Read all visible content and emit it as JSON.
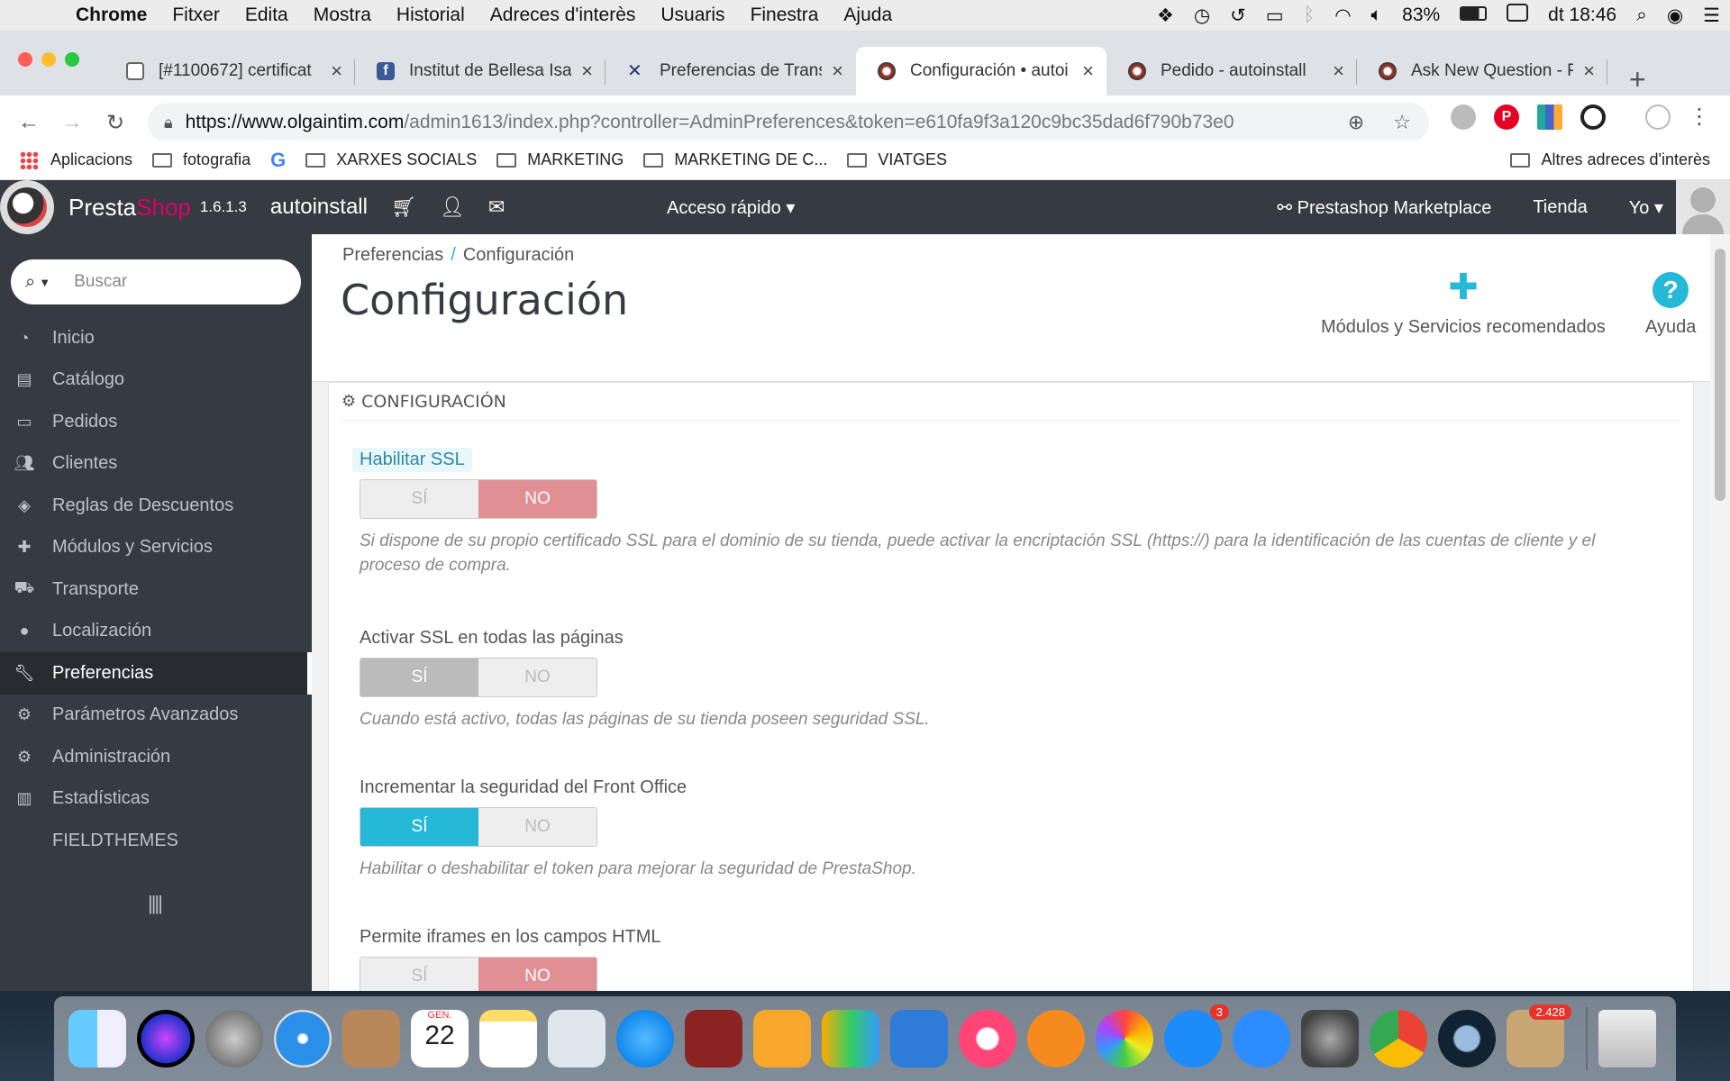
{
  "menubar": {
    "app": "Chrome",
    "items": [
      "Fitxer",
      "Edita",
      "Mostra",
      "Historial",
      "Adreces d'interès",
      "Usuaris",
      "Finestra",
      "Ajuda"
    ],
    "battery": "83%",
    "clock": "dt 18:46"
  },
  "tabs": [
    {
      "label": "[#1100672] certificat",
      "color": "#888888"
    },
    {
      "label": "Institut de Bellesa Isa",
      "color": "#3b5998"
    },
    {
      "label": "Preferencias de Trans",
      "color": "#1a3a6e"
    },
    {
      "label": "Configuración • autoi",
      "color": "#c0392b"
    },
    {
      "label": "Pedido - autoinstall",
      "color": "#c0392b"
    },
    {
      "label": "Ask New Question - P",
      "color": "#c0392b"
    }
  ],
  "address": {
    "host": "https://www.olgaintim.com",
    "path": "/admin1613/index.php?controller=AdminPreferences&token=e610fa9f3a120c9bc35dad6f790b73e0"
  },
  "bookmarks": {
    "apps": "Aplicacions",
    "items": [
      "fotografia",
      "XARXES SOCIALS",
      "MARKETING",
      "MARKETING DE C...",
      "VIATGES"
    ],
    "other": "Altres adreces d'interès"
  },
  "header": {
    "brand_a": "Presta",
    "brand_b": "Shop",
    "version": "1.6.1.3",
    "shop_name": "autoinstall",
    "quick_access": "Acceso rápido",
    "marketplace": "Prestashop Marketplace",
    "store": "Tienda",
    "me": "Yo"
  },
  "sidebar": {
    "search_placeholder": "Buscar",
    "items": [
      {
        "label": "Inicio",
        "icon": "dashboard-icon"
      },
      {
        "label": "Catálogo",
        "icon": "book-icon"
      },
      {
        "label": "Pedidos",
        "icon": "credit-card-icon"
      },
      {
        "label": "Clientes",
        "icon": "users-icon"
      },
      {
        "label": "Reglas de Descuentos",
        "icon": "tags-icon"
      },
      {
        "label": "Módulos y Servicios",
        "icon": "puzzle-icon"
      },
      {
        "label": "Transporte",
        "icon": "truck-icon"
      },
      {
        "label": "Localización",
        "icon": "globe-icon"
      },
      {
        "label": "Preferencias",
        "icon": "wrench-icon"
      },
      {
        "label": "Parámetros Avanzados",
        "icon": "cogs-icon"
      },
      {
        "label": "Administración",
        "icon": "cog-icon"
      },
      {
        "label": "Estadísticas",
        "icon": "bar-chart-icon"
      },
      {
        "label": "FIELDTHEMES",
        "icon": ""
      }
    ]
  },
  "page": {
    "breadcrumb": [
      "Preferencias",
      "Configuración"
    ],
    "title": "Configuración",
    "modules_btn": "Módulos y Servicios recomendados",
    "help_btn": "Ayuda"
  },
  "panel": {
    "heading": "Configuración",
    "fields": [
      {
        "label": "Habilitar SSL",
        "yes": "SÍ",
        "no": "NO",
        "value": "no",
        "help": "Si dispone de su propio certificado SSL para el dominio de su tienda, puede activar la encriptación SSL (https://) para la identificación de las cuentas de cliente y el proceso de compra."
      },
      {
        "label": "Activar SSL en todas las páginas",
        "yes": "SÍ",
        "no": "NO",
        "value": "yes-disabled",
        "help": "Cuando está activo, todas las páginas de su tienda poseen seguridad SSL."
      },
      {
        "label": "Incrementar la seguridad del Front Office",
        "yes": "SÍ",
        "no": "NO",
        "value": "yes",
        "help": "Habilitar o deshabilitar el token para mejorar la seguridad de PrestaShop."
      },
      {
        "label": "Permite iframes en los campos HTML",
        "yes": "SÍ",
        "no": "NO",
        "value": "no",
        "help": ""
      }
    ]
  },
  "dock": {
    "calendar_month": "GEN.",
    "calendar_day": "22",
    "appstore_badge": "3",
    "mail_badge": "2.428"
  }
}
